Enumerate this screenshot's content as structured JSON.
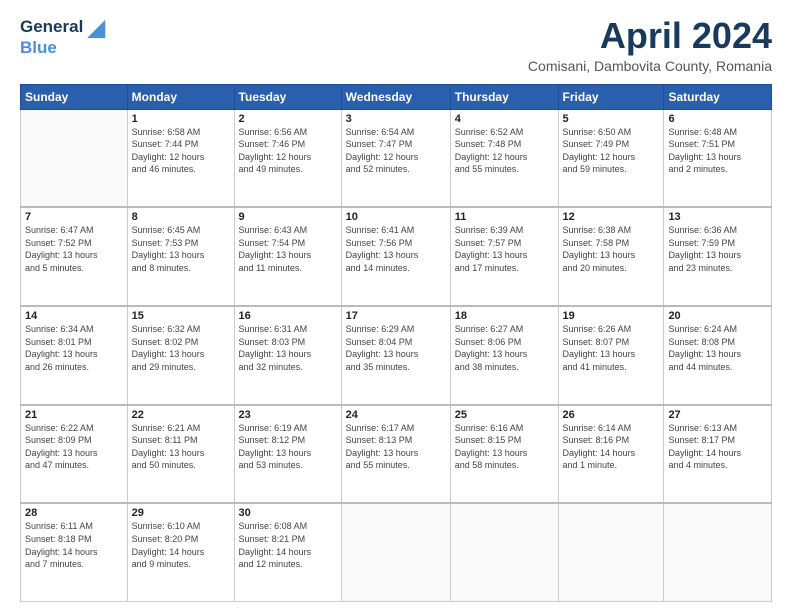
{
  "logo": {
    "line1": "General",
    "line2": "Blue"
  },
  "title": "April 2024",
  "subtitle": "Comisani, Dambovita County, Romania",
  "days_of_week": [
    "Sunday",
    "Monday",
    "Tuesday",
    "Wednesday",
    "Thursday",
    "Friday",
    "Saturday"
  ],
  "weeks": [
    [
      {
        "day": "",
        "info": ""
      },
      {
        "day": "1",
        "info": "Sunrise: 6:58 AM\nSunset: 7:44 PM\nDaylight: 12 hours\nand 46 minutes."
      },
      {
        "day": "2",
        "info": "Sunrise: 6:56 AM\nSunset: 7:46 PM\nDaylight: 12 hours\nand 49 minutes."
      },
      {
        "day": "3",
        "info": "Sunrise: 6:54 AM\nSunset: 7:47 PM\nDaylight: 12 hours\nand 52 minutes."
      },
      {
        "day": "4",
        "info": "Sunrise: 6:52 AM\nSunset: 7:48 PM\nDaylight: 12 hours\nand 55 minutes."
      },
      {
        "day": "5",
        "info": "Sunrise: 6:50 AM\nSunset: 7:49 PM\nDaylight: 12 hours\nand 59 minutes."
      },
      {
        "day": "6",
        "info": "Sunrise: 6:48 AM\nSunset: 7:51 PM\nDaylight: 13 hours\nand 2 minutes."
      }
    ],
    [
      {
        "day": "7",
        "info": "Sunrise: 6:47 AM\nSunset: 7:52 PM\nDaylight: 13 hours\nand 5 minutes."
      },
      {
        "day": "8",
        "info": "Sunrise: 6:45 AM\nSunset: 7:53 PM\nDaylight: 13 hours\nand 8 minutes."
      },
      {
        "day": "9",
        "info": "Sunrise: 6:43 AM\nSunset: 7:54 PM\nDaylight: 13 hours\nand 11 minutes."
      },
      {
        "day": "10",
        "info": "Sunrise: 6:41 AM\nSunset: 7:56 PM\nDaylight: 13 hours\nand 14 minutes."
      },
      {
        "day": "11",
        "info": "Sunrise: 6:39 AM\nSunset: 7:57 PM\nDaylight: 13 hours\nand 17 minutes."
      },
      {
        "day": "12",
        "info": "Sunrise: 6:38 AM\nSunset: 7:58 PM\nDaylight: 13 hours\nand 20 minutes."
      },
      {
        "day": "13",
        "info": "Sunrise: 6:36 AM\nSunset: 7:59 PM\nDaylight: 13 hours\nand 23 minutes."
      }
    ],
    [
      {
        "day": "14",
        "info": "Sunrise: 6:34 AM\nSunset: 8:01 PM\nDaylight: 13 hours\nand 26 minutes."
      },
      {
        "day": "15",
        "info": "Sunrise: 6:32 AM\nSunset: 8:02 PM\nDaylight: 13 hours\nand 29 minutes."
      },
      {
        "day": "16",
        "info": "Sunrise: 6:31 AM\nSunset: 8:03 PM\nDaylight: 13 hours\nand 32 minutes."
      },
      {
        "day": "17",
        "info": "Sunrise: 6:29 AM\nSunset: 8:04 PM\nDaylight: 13 hours\nand 35 minutes."
      },
      {
        "day": "18",
        "info": "Sunrise: 6:27 AM\nSunset: 8:06 PM\nDaylight: 13 hours\nand 38 minutes."
      },
      {
        "day": "19",
        "info": "Sunrise: 6:26 AM\nSunset: 8:07 PM\nDaylight: 13 hours\nand 41 minutes."
      },
      {
        "day": "20",
        "info": "Sunrise: 6:24 AM\nSunset: 8:08 PM\nDaylight: 13 hours\nand 44 minutes."
      }
    ],
    [
      {
        "day": "21",
        "info": "Sunrise: 6:22 AM\nSunset: 8:09 PM\nDaylight: 13 hours\nand 47 minutes."
      },
      {
        "day": "22",
        "info": "Sunrise: 6:21 AM\nSunset: 8:11 PM\nDaylight: 13 hours\nand 50 minutes."
      },
      {
        "day": "23",
        "info": "Sunrise: 6:19 AM\nSunset: 8:12 PM\nDaylight: 13 hours\nand 53 minutes."
      },
      {
        "day": "24",
        "info": "Sunrise: 6:17 AM\nSunset: 8:13 PM\nDaylight: 13 hours\nand 55 minutes."
      },
      {
        "day": "25",
        "info": "Sunrise: 6:16 AM\nSunset: 8:15 PM\nDaylight: 13 hours\nand 58 minutes."
      },
      {
        "day": "26",
        "info": "Sunrise: 6:14 AM\nSunset: 8:16 PM\nDaylight: 14 hours\nand 1 minute."
      },
      {
        "day": "27",
        "info": "Sunrise: 6:13 AM\nSunset: 8:17 PM\nDaylight: 14 hours\nand 4 minutes."
      }
    ],
    [
      {
        "day": "28",
        "info": "Sunrise: 6:11 AM\nSunset: 8:18 PM\nDaylight: 14 hours\nand 7 minutes."
      },
      {
        "day": "29",
        "info": "Sunrise: 6:10 AM\nSunset: 8:20 PM\nDaylight: 14 hours\nand 9 minutes."
      },
      {
        "day": "30",
        "info": "Sunrise: 6:08 AM\nSunset: 8:21 PM\nDaylight: 14 hours\nand 12 minutes."
      },
      {
        "day": "",
        "info": ""
      },
      {
        "day": "",
        "info": ""
      },
      {
        "day": "",
        "info": ""
      },
      {
        "day": "",
        "info": ""
      }
    ]
  ]
}
